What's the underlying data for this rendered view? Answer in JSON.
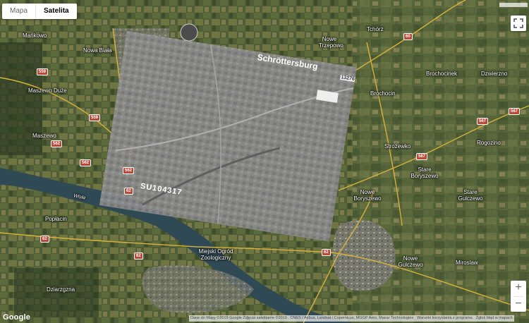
{
  "map_type": {
    "map_label": "Mapa",
    "satellite_label": "Satelita",
    "active": "Satelita"
  },
  "zoom": {
    "in_label": "+",
    "out_label": "−"
  },
  "logo": "Google",
  "attribution": {
    "data": "Dane do Mapy ©2019 Google Zdjęcia satelitarne ©2019 , CNES / Airbus, Landsat / Copernicus, MGGP Aero, Maxar Technologies",
    "terms": "Warunki korzystania z programu",
    "report": "Zgłoś błąd w mapach"
  },
  "places": [
    {
      "name": "Mańkowo"
    },
    {
      "name": "Nowa Biała"
    },
    {
      "name": "Maszewo Duże"
    },
    {
      "name": "Maszewo"
    },
    {
      "name": "Tchórz"
    },
    {
      "name": "Nowe Trzepowo"
    },
    {
      "name": "Brochocinek"
    },
    {
      "name": "Dzwierzno"
    },
    {
      "name": "Brochocin"
    },
    {
      "name": "Strożewko"
    },
    {
      "name": "Rogozino"
    },
    {
      "name": "Stare Boryszewo"
    },
    {
      "name": "Nowe Boryszewo"
    },
    {
      "name": "Stare Gulczewo"
    },
    {
      "name": "Nowe Gulczewo"
    },
    {
      "name": "Miroslaw"
    },
    {
      "name": "Popłacin"
    },
    {
      "name": "Dziarzgzna"
    },
    {
      "name": "Miejski Ogród Zoologiczny"
    },
    {
      "name": "Wisła"
    }
  ],
  "roads": [
    "559",
    "559",
    "562",
    "562",
    "562",
    "62",
    "62",
    "62",
    "62",
    "567",
    "567",
    "567",
    "60"
  ],
  "overlay": {
    "title": "Schröttersburg",
    "stamp": "SU104317",
    "number": "13276"
  },
  "colors": {
    "land": "#4a5a35",
    "river": "#2f4a55",
    "overlay": "#8a8a8a",
    "road": "#d8b23a"
  }
}
